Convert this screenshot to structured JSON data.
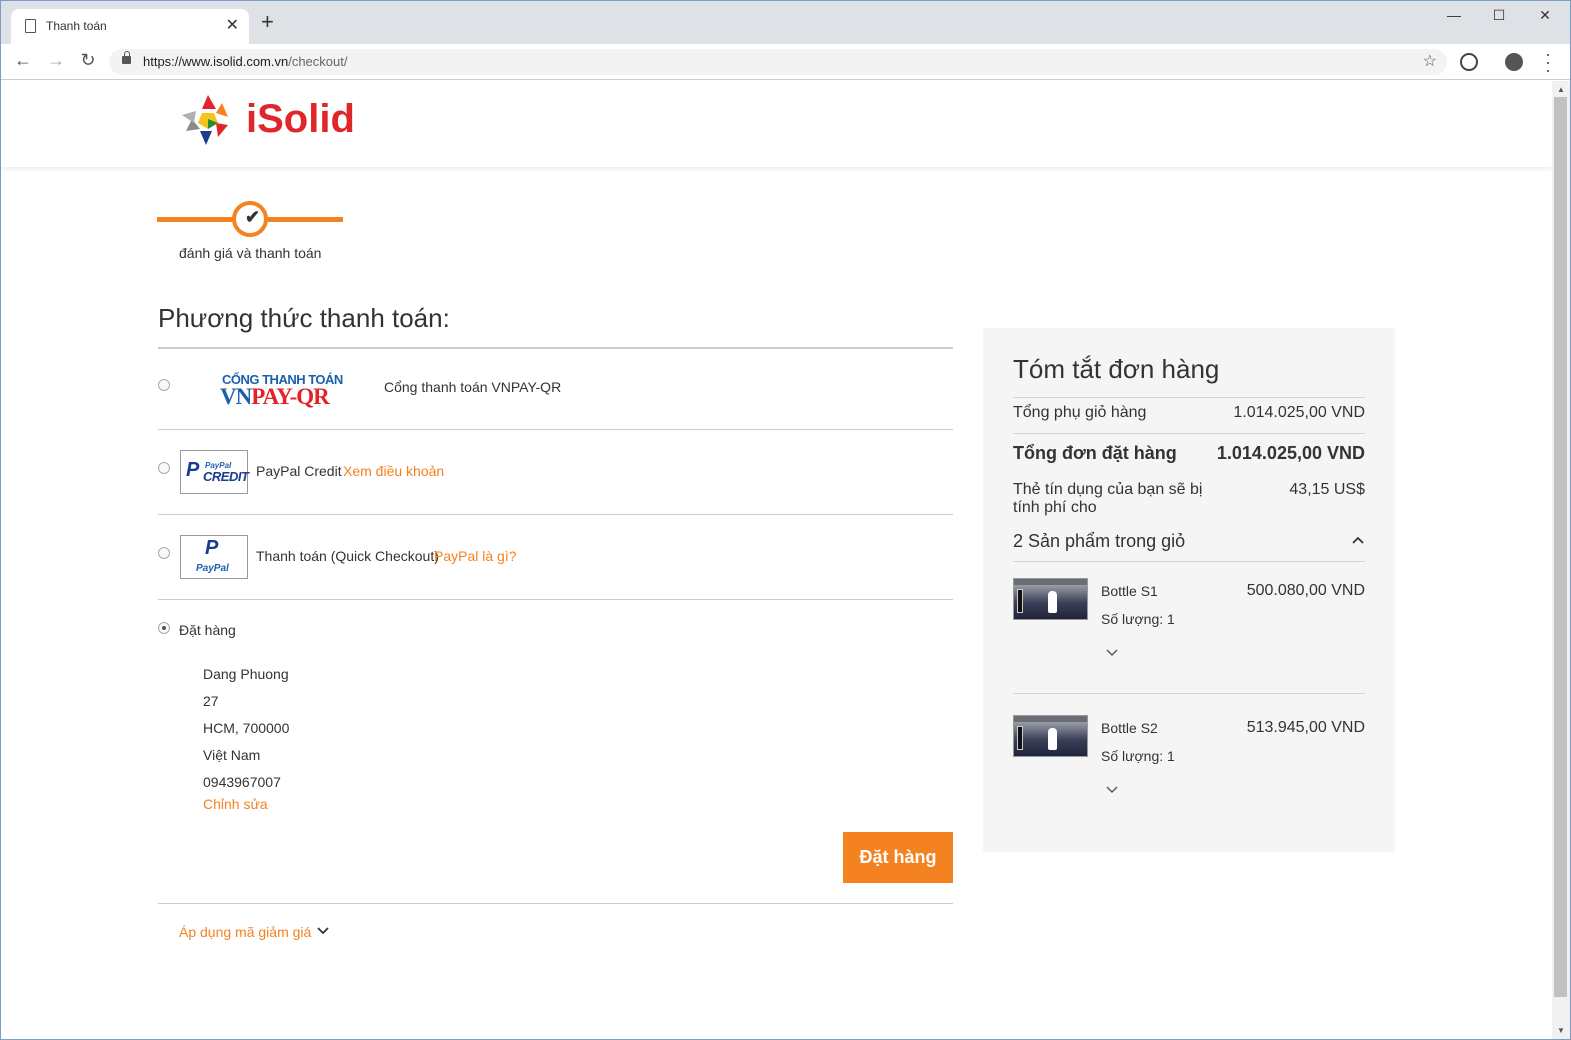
{
  "browser": {
    "tab_title": "Thanh toán",
    "url_host": "https://www.isolid.com.vn",
    "url_path": "/checkout/"
  },
  "header": {
    "brand": "iSolid"
  },
  "progress": {
    "step_label": "đánh giá và thanh toán"
  },
  "payment": {
    "section_title": "Phương thức thanh toán:",
    "vnpay_logo_top": "CỔNG THANH TOÁN",
    "vnpay_logo_bottom_a": "VN",
    "vnpay_logo_bottom_b": "PAY-QR",
    "vnpay_label": "Cổng thanh toán VNPAY-QR",
    "paypal_credit_label": "PayPal Credit",
    "paypal_credit_link": "Xem điều khoản",
    "paypal_credit_logo_top": "PayPal",
    "paypal_credit_logo_bottom": "CREDIT",
    "paypal_label": "Thanh toán (Quick Checkout)",
    "paypal_link": "PayPal là gì?",
    "paypal_logo_text": "PayPal",
    "order_label": "Đặt hàng",
    "address": [
      "Dang Phuong",
      "27",
      "HCM, 700000",
      "Việt Nam",
      "0943967007"
    ],
    "edit_link": "Chỉnh sửa",
    "place_order_button": "Đặt hàng",
    "discount_link": "Áp dụng mã giảm giá"
  },
  "summary": {
    "title": "Tóm tắt đơn hàng",
    "subtotal_label": "Tổng phụ giỏ hàng",
    "subtotal_value": "1.014.025,00 VND",
    "total_label": "Tổng đơn đặt hàng",
    "total_value": "1.014.025,00 VND",
    "charge_label": "Thẻ tín dụng của bạn sẽ bị tính phí cho",
    "charge_value": "43,15 US$",
    "cart_count": "2 Sản phẩm trong giỏ",
    "items": [
      {
        "name": "Bottle S1",
        "qty": "Số lượng: 1",
        "price": "500.080,00 VND"
      },
      {
        "name": "Bottle S2",
        "qty": "Số lượng: 1",
        "price": "513.945,00 VND"
      }
    ]
  },
  "colors": {
    "accent": "#f58220",
    "brand_red": "#e0262b",
    "summary_bg": "#f5f5f5"
  }
}
